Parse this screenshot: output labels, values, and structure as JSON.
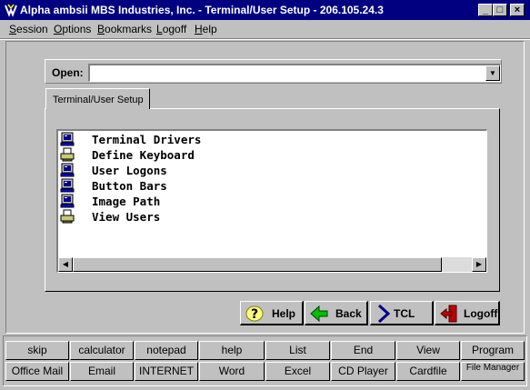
{
  "window": {
    "title": "Alpha ambsii MBS Industries, Inc. - Terminal/User Setup - 206.105.24.3",
    "minimize_label": "_",
    "maximize_label": "□",
    "close_label": "×"
  },
  "menu": {
    "session": {
      "u": "S",
      "rest": "ession"
    },
    "options": {
      "u": "O",
      "rest": "ptions"
    },
    "bookmarks": {
      "u": "B",
      "rest": "ookmarks"
    },
    "logoff": {
      "u": "L",
      "rest": "ogoff"
    },
    "help": {
      "u": "H",
      "rest": "elp"
    }
  },
  "open": {
    "label": "Open:",
    "value": ""
  },
  "tab": {
    "label": "Terminal/User Setup"
  },
  "list": {
    "items": [
      {
        "label": "Terminal Drivers",
        "icon": "terminal-icon"
      },
      {
        "label": "Define Keyboard",
        "icon": "printer-icon"
      },
      {
        "label": "User Logons",
        "icon": "terminal-icon"
      },
      {
        "label": "Button Bars",
        "icon": "terminal-icon"
      },
      {
        "label": "Image Path",
        "icon": "terminal-icon"
      },
      {
        "label": "View Users",
        "icon": "printer-icon"
      }
    ]
  },
  "nav": {
    "help": "Help",
    "back": "Back",
    "tcl": "TCL",
    "logoff": "Logoff"
  },
  "shortcuts": {
    "row1": [
      "skip",
      "calculator",
      "notepad",
      "help",
      "List",
      "End",
      "View",
      "Program"
    ],
    "row2": [
      "Office Mail",
      "Email",
      "INTERNET",
      "Word",
      "Excel",
      "CD Player",
      "Cardfile",
      "File Manager"
    ]
  },
  "colors": {
    "titlebar": "#000080",
    "face": "#c0c0c0"
  }
}
